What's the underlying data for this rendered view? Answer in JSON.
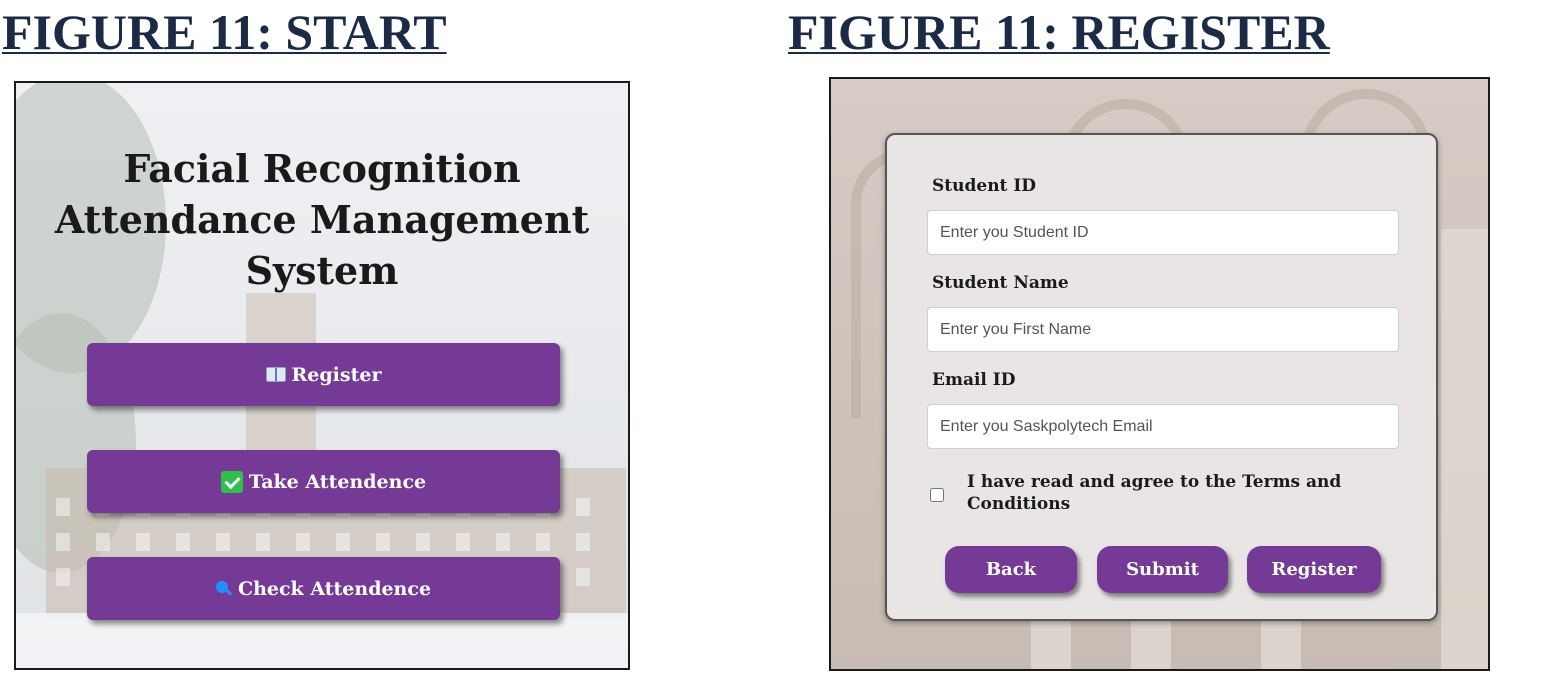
{
  "figures": {
    "start_title": "FIGURE 11: START",
    "register_title": "FIGURE 11: REGISTER"
  },
  "start_screen": {
    "title_lines": [
      "Facial Recognition",
      "Attendance Management",
      "System"
    ],
    "buttons": [
      {
        "label": "Register",
        "icon": "open-book-icon"
      },
      {
        "label": "Take Attendence",
        "icon": "check-mark-icon"
      },
      {
        "label": "Check Attendence",
        "icon": "magnifier-icon"
      }
    ]
  },
  "register_form": {
    "fields": [
      {
        "label": "Student ID",
        "placeholder": "Enter you Student ID"
      },
      {
        "label": "Student Name",
        "placeholder": "Enter you First Name"
      },
      {
        "label": "Email ID",
        "placeholder": "Enter you Saskpolytech Email"
      }
    ],
    "terms_text": "I have read and agree to the Terms and Conditions",
    "buttons": [
      "Back",
      "Submit",
      "Register"
    ]
  },
  "colors": {
    "button_purple": "#753a96",
    "title_navy": "#1c2b45"
  }
}
